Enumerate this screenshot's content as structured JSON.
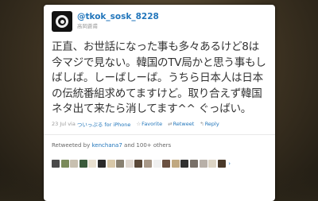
{
  "tweet": {
    "screen_name": "@tkok_sosk_8228",
    "real_name": "高岡蒼甫",
    "text": "正直、お世話になった事も多々あるけど8は今マジで見ない。韓国のTV局かと思う事もしばしば。しーばしーば。うちら日本人は日本の伝統番組求めてますけど。取り合えず韓国ネタ出て来たら消してます^^ ぐっばい。",
    "date": "23 Jul",
    "via": "via",
    "source": "ついっぷる for iPhone",
    "favorite_label": "Favorite",
    "retweet_label": "Retweet",
    "reply_label": "Reply",
    "favorite_icon": "star-icon",
    "retweet_icon": "retweet-icon",
    "reply_icon": "reply-arrow-icon"
  },
  "retweets": {
    "prefix": "Retweeted by",
    "user": "kenchana7",
    "suffix": "and 100+ others",
    "avatar_colors": [
      "#4a4a4a",
      "#7a8a5a",
      "#c8c0b0",
      "#3a5a3a",
      "#e8e0d0",
      "#2a2a2a",
      "#d8c8a8",
      "#888070",
      "#e0d8d0",
      "#5a4838",
      "#a89888",
      "#f0f0f0",
      "#6a5040",
      "#c0a880",
      "#303030",
      "#787068",
      "#b8b0a8",
      "#dcd4c4",
      "#4a3a2a"
    ],
    "more": "›"
  },
  "colors": {
    "link": "#2276bb",
    "text": "#333333",
    "muted": "#999999"
  }
}
